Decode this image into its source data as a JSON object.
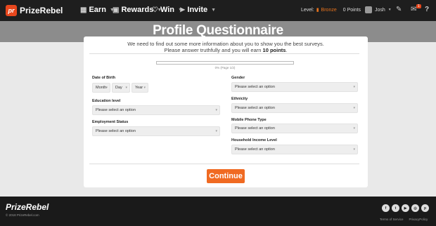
{
  "nav": {
    "brand": "PrizeRebel",
    "items": [
      {
        "label": "Earn",
        "icon": "earn-icon"
      },
      {
        "label": "Rewards",
        "icon": "gift-icon"
      },
      {
        "label": "Win",
        "icon": "heart-icon"
      },
      {
        "label": "Invite",
        "icon": "send-icon"
      }
    ],
    "level_label": "Level:",
    "level_value": "Bronze",
    "points": "0 Points",
    "user": "Josh",
    "mail_badge": "1",
    "help": "?"
  },
  "hero": {
    "title": "Profile Questionnaire"
  },
  "card": {
    "intro_line1": "We need to find out some more information about you to show you the best surveys.",
    "intro_line2": "Please answer truthfully and you will earn",
    "intro_points": "10 points",
    "intro_end": ".",
    "progress": 0,
    "progress_label": "0% (Page 1/2)",
    "dob_label": "Date of Birth",
    "dob_month": "Month",
    "dob_day": "Day",
    "dob_year": "Year",
    "education_label": "Education level",
    "education_value": "Please select an option",
    "employment_label": "Employment Status",
    "employment_value": "Please select an option",
    "gender_label": "Gender",
    "gender_value": "Please select an option",
    "ethnicity_label": "Ethnicity",
    "ethnicity_value": "Please select an option",
    "mobile_label": "Mobile Phone Type",
    "mobile_value": "Please select an option",
    "income_label": "Household Income Level",
    "income_value": "Please select an option",
    "continue_label": "Continue"
  },
  "footer": {
    "brand": "PrizeRebel",
    "copyright": "© 2018 PrizeRebel.com",
    "terms": "Terms of Service",
    "privacy": "PrivacyPolicy",
    "socials": [
      "facebook-icon",
      "twitter-icon",
      "youtube-icon",
      "instagram-icon",
      "pinterest-icon"
    ]
  },
  "colors": {
    "accent": "#f06a22",
    "nav_bg": "#1e1e1e",
    "hero_bg": "#8c8c8c"
  }
}
